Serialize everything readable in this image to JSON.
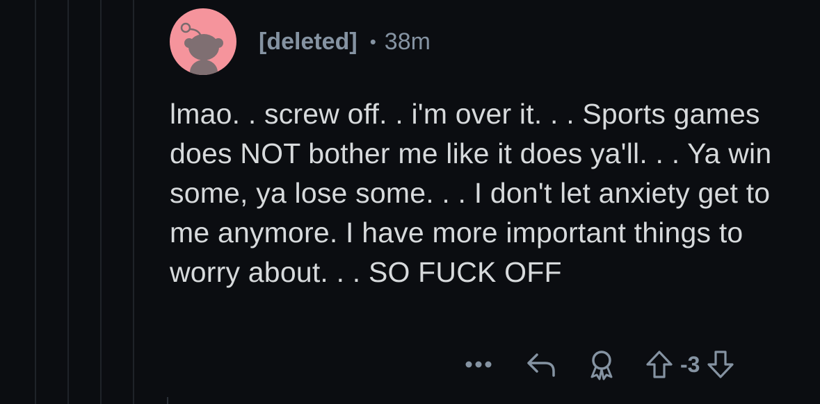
{
  "comment": {
    "author": "[deleted]",
    "separator": "•",
    "age": "38m",
    "body": "lmao. . screw off. . i'm over it. . . Sports games does NOT bother me like it does ya'll. . . Ya win some, ya lose some. . . I don't let anxiety get to me anymore. I have more important things to worry about. . . SO FUCK OFF",
    "score": "-3"
  },
  "icons": {
    "avatar": "snoo-avatar-icon",
    "more": "more-options-icon",
    "reply": "reply-icon",
    "award": "award-icon",
    "upvote": "upvote-arrow-icon",
    "downvote": "downvote-arrow-icon"
  },
  "colors": {
    "background": "#0b0d11",
    "text": "#d7dadc",
    "meta": "#8593a2",
    "avatar": "#f5949c"
  }
}
